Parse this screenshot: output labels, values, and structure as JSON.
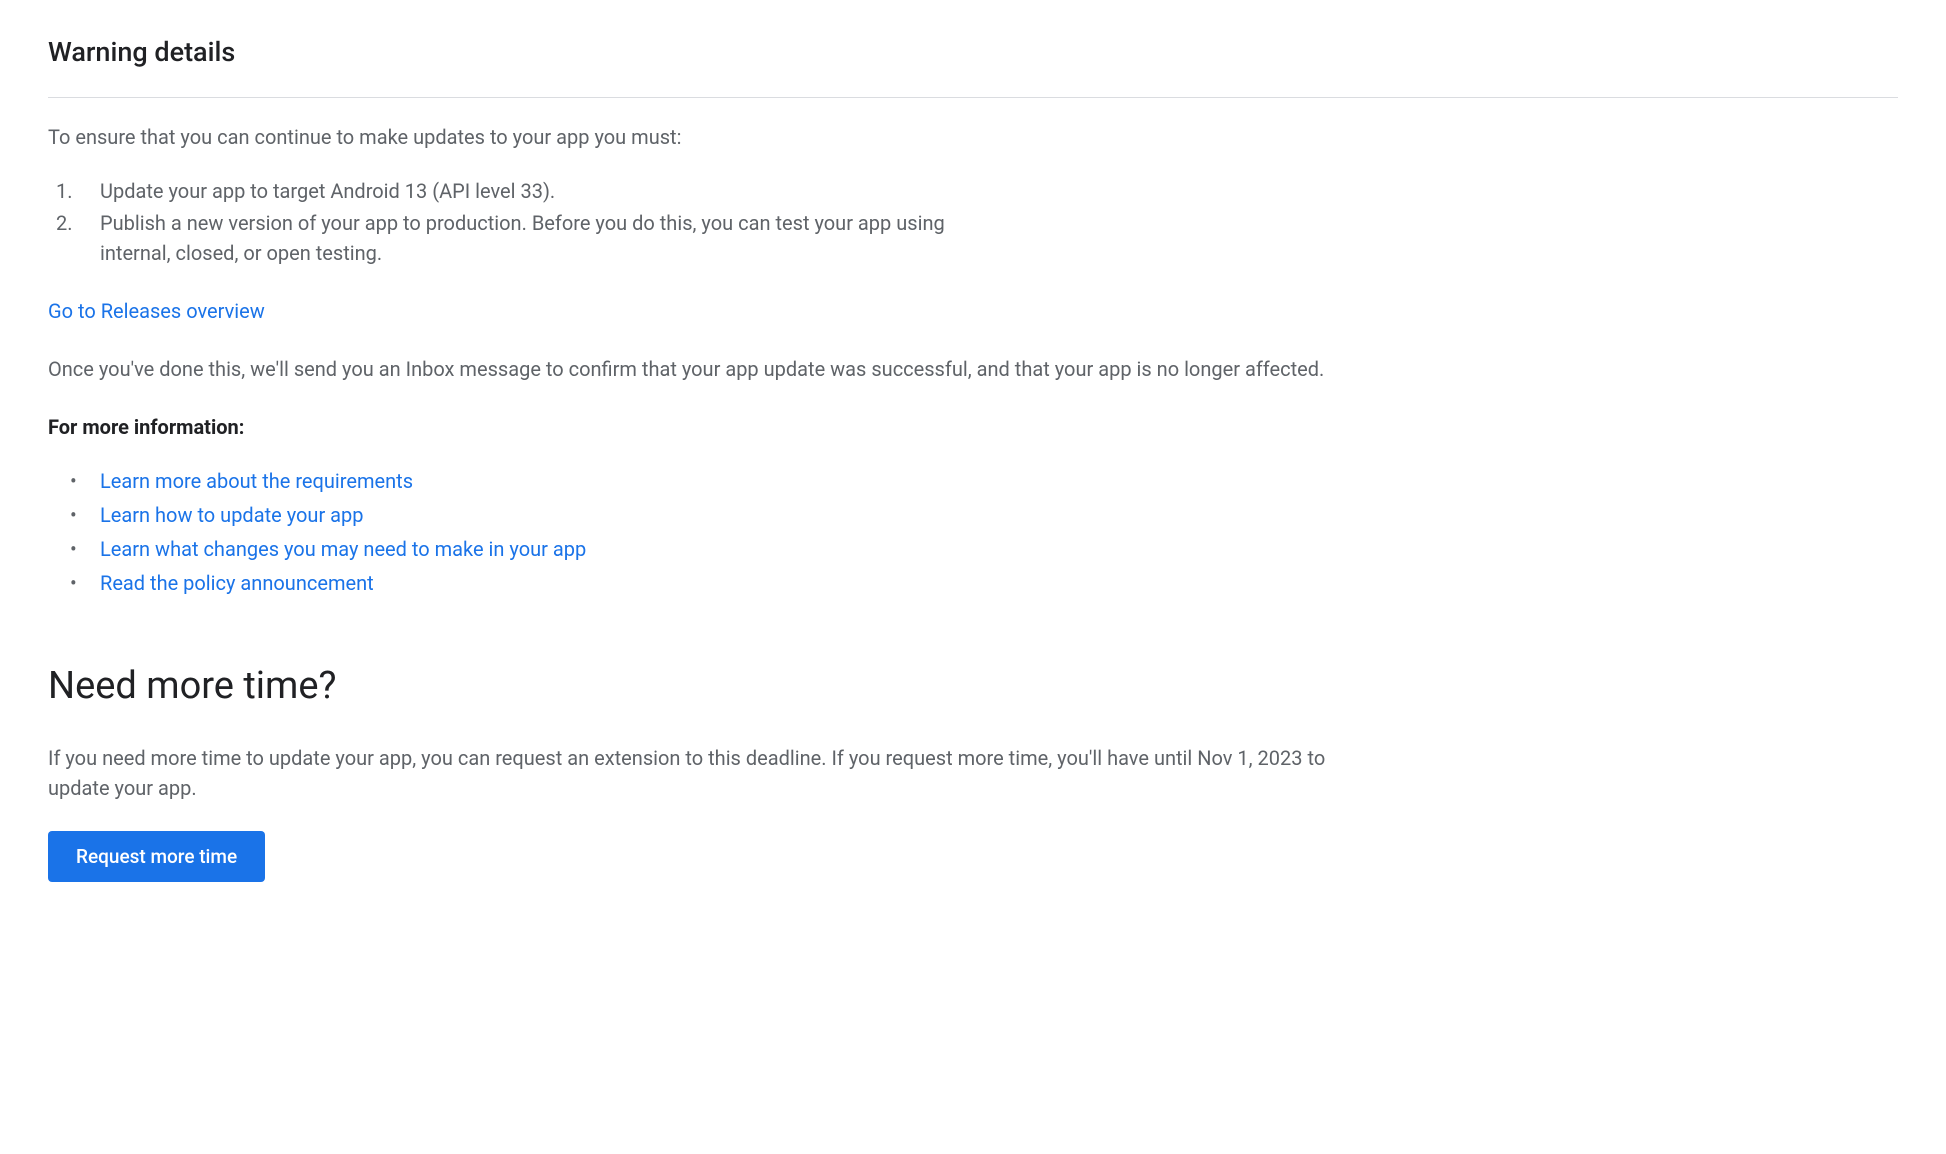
{
  "header": {
    "title": "Warning details"
  },
  "intro": "To ensure that you can continue to make updates to your app you must:",
  "steps": [
    "Update your app to target Android 13 (API level 33).",
    "Publish a new version of your app to production. Before you do this, you can test your app using internal, closed, or open testing."
  ],
  "releases_link": "Go to Releases overview",
  "confirmation_text": "Once you've done this, we'll send you an Inbox message to confirm that your app update was successful, and that your app is no longer affected.",
  "more_info_heading": "For more information:",
  "info_links": [
    "Learn more about the requirements",
    "Learn how to update your app",
    "Learn what changes you may need to make in your app",
    "Read the policy announcement"
  ],
  "need_time": {
    "heading": "Need more time?",
    "body": "If you need more time to update your app, you can request an extension to this deadline. If you request more time, you'll have until Nov 1, 2023 to update your app.",
    "button": "Request more time"
  }
}
